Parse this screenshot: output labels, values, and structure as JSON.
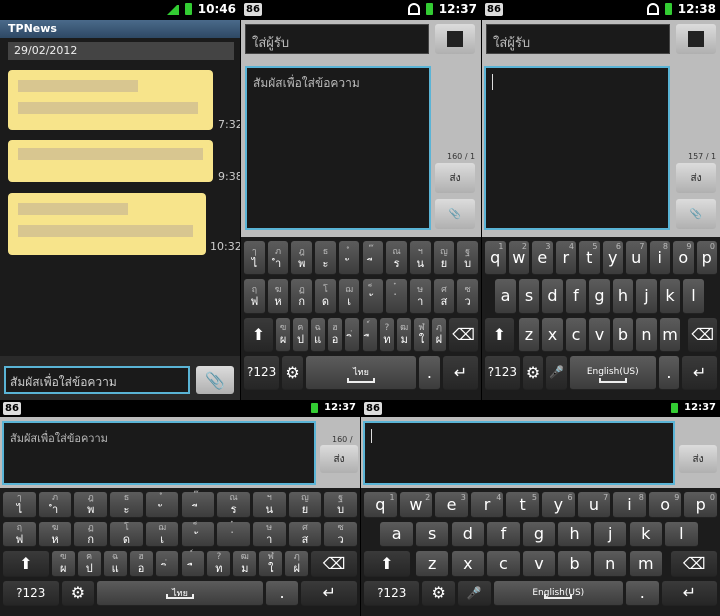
{
  "p1": {
    "status_time": "10:46",
    "app_title": "TPNews",
    "date": "29/02/2012",
    "messages": [
      {
        "time": "7:32"
      },
      {
        "time": "9:38"
      },
      {
        "time": "10:32"
      }
    ],
    "input_placeholder": "สัมผัสเพื่อใส่ข้อความ"
  },
  "p2": {
    "badge": "86",
    "status_time": "12:37",
    "to_placeholder": "ใส่ผู้รับ",
    "body_placeholder": "สัมผัสเพื่อใส่ข้อความ",
    "counter": "160 / 1",
    "send": "ส่ง"
  },
  "p3": {
    "badge": "86",
    "status_time": "12:38",
    "to_placeholder": "ใส่ผู้รับ",
    "counter": "157 / 1",
    "send": "ส่ง"
  },
  "p4": {
    "badge": "86",
    "status_time": "12:37",
    "body_placeholder": "สัมผัสเพื่อใส่ข้อความ",
    "counter": "160 / 1",
    "send": "ส่ง"
  },
  "p5": {
    "badge": "86",
    "status_time": "12:37",
    "send": "ส่ง"
  },
  "thai_rows": [
    [
      [
        "ไ",
        "ๅ"
      ],
      [
        "ำ",
        "ภ"
      ],
      [
        "พ",
        "ฎ"
      ],
      [
        "ะ",
        "ธ"
      ],
      [
        "ั",
        "ํ"
      ],
      [
        "ี",
        "๊"
      ],
      [
        "ร",
        "ณ"
      ],
      [
        "น",
        "ฯ"
      ],
      [
        "ย",
        "ญ"
      ],
      [
        "บ",
        "ฐ"
      ]
    ],
    [
      [
        "ฟ",
        "ฤ"
      ],
      [
        "ห",
        "ฆ"
      ],
      [
        "ก",
        "ฏ"
      ],
      [
        "ด",
        "โ"
      ],
      [
        "เ",
        "ฌ"
      ],
      [
        "้",
        "็"
      ],
      [
        "่",
        "๋"
      ],
      [
        "า",
        "ษ"
      ],
      [
        "ส",
        "ศ"
      ],
      [
        "ว",
        "ซ"
      ]
    ],
    [
      [
        "ผ",
        "ฃ"
      ],
      [
        "ป",
        "ฅ"
      ],
      [
        "แ",
        "ฉ"
      ],
      [
        "อ",
        "ฮ"
      ],
      [
        "ิ",
        "ฺ"
      ],
      [
        "ื",
        "์"
      ],
      [
        "ท",
        "?"
      ],
      [
        "ม",
        "ฒ"
      ],
      [
        "ใ",
        "ฬ"
      ],
      [
        "ฝ",
        "ฦ"
      ]
    ]
  ],
  "qwerty": [
    [
      "q",
      "w",
      "e",
      "r",
      "t",
      "y",
      "u",
      "i",
      "o",
      "p"
    ],
    [
      "a",
      "s",
      "d",
      "f",
      "g",
      "h",
      "j",
      "k",
      "l"
    ],
    [
      "z",
      "x",
      "c",
      "v",
      "b",
      "n",
      "m"
    ]
  ],
  "qwerty_sub": [
    [
      "1",
      "2",
      "3",
      "4",
      "5",
      "6",
      "7",
      "8",
      "9",
      "0"
    ]
  ],
  "keys": {
    "num": "?123",
    "thai_lang": "ไทย",
    "eng_lang": "English(US)",
    "period": ".",
    "shift": "⬆",
    "backspace": "⌫",
    "enter": "↵",
    "mic": "🎤",
    "gear": "⚙"
  }
}
